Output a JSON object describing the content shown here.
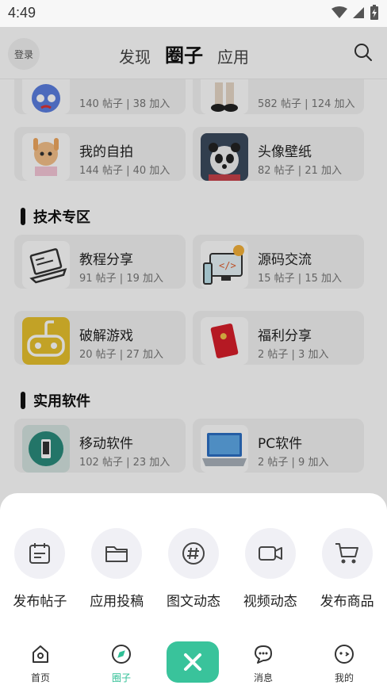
{
  "status_bar": {
    "time": "4:49"
  },
  "header": {
    "login_label": "登录",
    "tabs": [
      {
        "label": "发现",
        "active": false
      },
      {
        "label": "圈子",
        "active": true
      },
      {
        "label": "应用",
        "active": false
      }
    ],
    "search_icon": "search-icon"
  },
  "groups": {
    "row0": [
      {
        "title": "",
        "meta": "140 帖子 | 38 加入"
      },
      {
        "title": "",
        "meta": "582 帖子 | 124 加入"
      }
    ],
    "row1": [
      {
        "title": "我的自拍",
        "meta": "144 帖子 | 40 加入"
      },
      {
        "title": "头像壁纸",
        "meta": "82 帖子 | 21 加入"
      }
    ],
    "section_tech": "技术专区",
    "row2": [
      {
        "title": "教程分享",
        "meta": "91 帖子 | 19 加入"
      },
      {
        "title": "源码交流",
        "meta": "15 帖子 | 15 加入"
      }
    ],
    "row3": [
      {
        "title": "破解游戏",
        "meta": "20 帖子 | 27 加入"
      },
      {
        "title": "福利分享",
        "meta": "2 帖子 | 3 加入"
      }
    ],
    "section_software": "实用软件",
    "row4": [
      {
        "title": "移动软件",
        "meta": "102 帖子 | 23 加入"
      },
      {
        "title": "PC软件",
        "meta": "2 帖子 | 9 加入"
      }
    ]
  },
  "sheet": {
    "actions": [
      {
        "label": "发布帖子",
        "icon": "calendar-post-icon"
      },
      {
        "label": "应用投稿",
        "icon": "folder-icon"
      },
      {
        "label": "图文动态",
        "icon": "hashtag-icon"
      },
      {
        "label": "视频动态",
        "icon": "video-camera-icon"
      },
      {
        "label": "发布商品",
        "icon": "shopping-cart-icon"
      }
    ]
  },
  "bottom_nav": {
    "items": [
      {
        "label": "首页",
        "icon": "home-icon"
      },
      {
        "label": "圈子",
        "icon": "compass-icon",
        "active": true
      },
      {
        "label": "消息",
        "icon": "chat-icon"
      },
      {
        "label": "我的",
        "icon": "face-icon"
      }
    ],
    "close_icon": "close-icon"
  },
  "colors": {
    "accent": "#39c39b",
    "accent_text": "#2fbf95"
  }
}
